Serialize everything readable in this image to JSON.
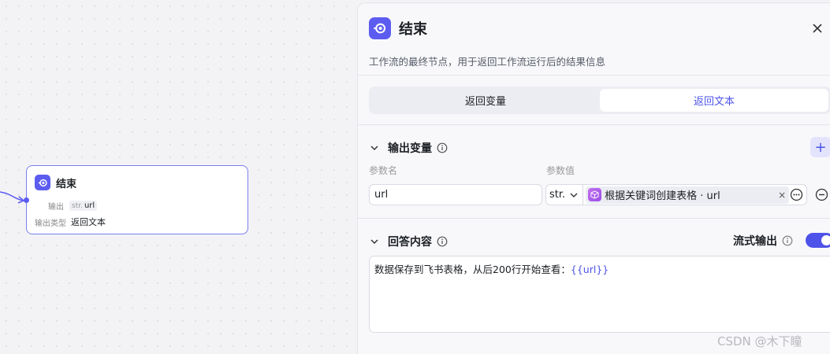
{
  "node": {
    "title": "结束",
    "output_label": "输出",
    "output_type_tag": "str.",
    "output_var": "url",
    "output_type_label": "输出类型",
    "output_type_value": "返回文本"
  },
  "panel": {
    "title": "结束",
    "description": "工作流的最终节点，用于返回工作流运行后的结果信息",
    "tabs": [
      {
        "label": "返回变量",
        "active": false
      },
      {
        "label": "返回文本",
        "active": true
      }
    ],
    "output_section": {
      "title": "输出变量",
      "add_label": "+",
      "name_col": "参数名",
      "value_col": "参数值",
      "row": {
        "name": "url",
        "type": "str.",
        "ref": "根据关键词创建表格 · url",
        "clear": "×"
      }
    },
    "answer_section": {
      "title": "回答内容",
      "stream_label": "流式输出",
      "stream_enabled": true,
      "text_prefix": "数据保存到飞书表格，从后200行开始查看：",
      "text_var": "{{url}}"
    }
  },
  "watermark": "CSDN @木下瞳",
  "colors": {
    "accent": "#4d53e8",
    "node_icon": "#5c5cf0",
    "ref_icon": "#b05cf0"
  }
}
